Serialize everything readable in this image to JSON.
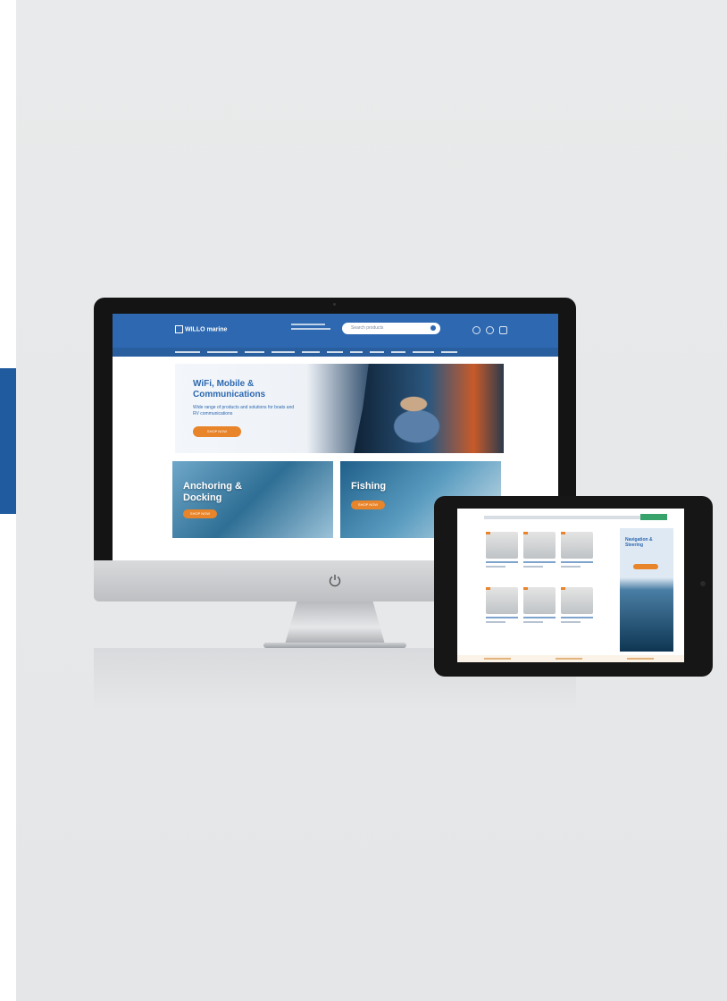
{
  "imac_site": {
    "logo": "WILLO marine",
    "search_placeholder": "Search products",
    "hero": {
      "title": "WiFi, Mobile & Communications",
      "subtitle": "Wide range of products and solutions for boats and RV communications",
      "button": "SHOP NOW"
    },
    "promos": [
      {
        "title": "Anchoring & Docking",
        "button": "SHOP NOW"
      },
      {
        "title": "Fishing",
        "button": "SHOP NOW"
      }
    ]
  },
  "ipad_site": {
    "banner_title": "Navigation & Steering"
  },
  "colors": {
    "brand_blue": "#2d68b0",
    "accent_orange": "#e8842a",
    "side_tab": "#1f5b9e",
    "background": "#e6e8ea"
  },
  "icons": [
    "power-icon",
    "search-icon",
    "cart-icon",
    "account-icon",
    "wishlist-icon"
  ]
}
